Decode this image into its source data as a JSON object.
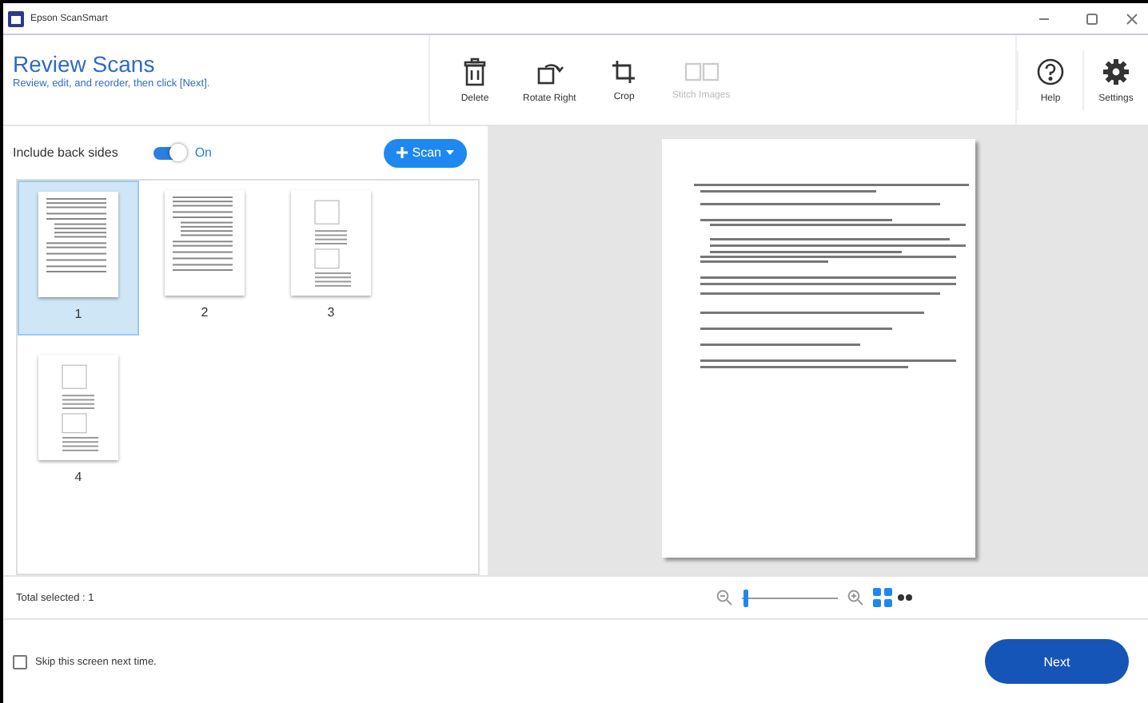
{
  "window": {
    "title": "Epson ScanSmart"
  },
  "header": {
    "title": "Review Scans",
    "subtitle": "Review, edit, and reorder, then click [Next]."
  },
  "toolbar": [
    {
      "label": "Delete",
      "kind": "trash",
      "disabled": false
    },
    {
      "label": "Rotate Right",
      "kind": "rotate",
      "disabled": false
    },
    {
      "label": "Crop",
      "kind": "crop",
      "disabled": false
    },
    {
      "label": "Stitch Images",
      "kind": "stitch",
      "disabled": true
    }
  ],
  "toolbar_right": [
    {
      "label": "Help",
      "kind": "help",
      "disabled": false
    },
    {
      "label": "Settings",
      "kind": "gear",
      "disabled": false
    }
  ],
  "back_sides": {
    "label": "Include back sides",
    "on": true,
    "state_label": "On"
  },
  "scan_button": "Scan",
  "thumbnails": [
    {
      "label": "1",
      "selected": true,
      "kind": "text"
    },
    {
      "label": "2",
      "selected": false,
      "kind": "text"
    },
    {
      "label": "3",
      "selected": false,
      "kind": "figures"
    },
    {
      "label": "4",
      "selected": false,
      "kind": "figures"
    }
  ],
  "status": "Total selected : 1",
  "zoom": {
    "level": 0.03
  },
  "view_modes": [
    {
      "kind": "grid",
      "selected": true
    },
    {
      "kind": "pair",
      "selected": false
    }
  ],
  "skip": {
    "label": "Skip this screen next time.",
    "checked": false
  },
  "next_button": "Next"
}
